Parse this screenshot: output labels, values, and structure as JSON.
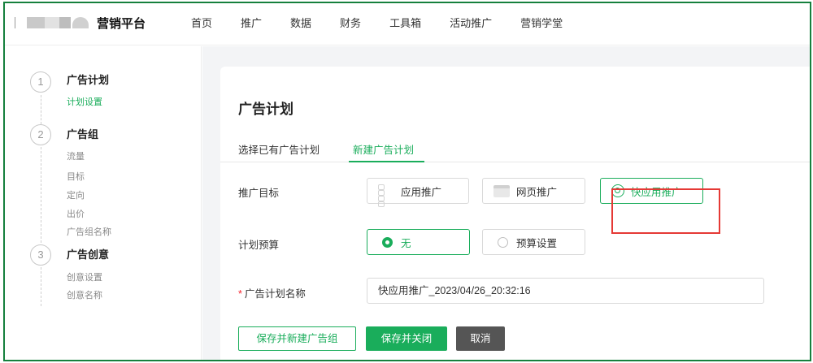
{
  "header": {
    "brand_title": "营销平台",
    "nav": [
      "首页",
      "推广",
      "数据",
      "财务",
      "工具箱",
      "活动推广",
      "营销学堂"
    ]
  },
  "sidebar": {
    "steps": [
      {
        "number": "1",
        "title": "广告计划",
        "items": [
          "计划设置"
        ]
      },
      {
        "number": "2",
        "title": "广告组",
        "items": [
          "流量",
          "目标",
          "定向",
          "出价",
          "广告组名称"
        ]
      },
      {
        "number": "3",
        "title": "广告创意",
        "items": [
          "创意设置",
          "创意名称"
        ]
      }
    ]
  },
  "main": {
    "title": "广告计划",
    "tabs": [
      "选择已有广告计划",
      "新建广告计划"
    ],
    "active_tab": 1,
    "goal": {
      "label": "推广目标",
      "options": [
        "应用推广",
        "网页推广",
        "快应用推广"
      ],
      "selected": 2
    },
    "budget": {
      "label": "计划预算",
      "options": [
        "无",
        "预算设置"
      ],
      "selected": 0
    },
    "plan_name": {
      "required_mark": "*",
      "label": "广告计划名称",
      "value": "快应用推广_2023/04/26_20:32:16"
    },
    "buttons": {
      "save_and_new": "保存并新建广告组",
      "save_and_close": "保存并关闭",
      "cancel": "取消"
    }
  },
  "colors": {
    "accent": "#1aad5b",
    "frame": "#15803d",
    "highlight": "#e53935"
  }
}
